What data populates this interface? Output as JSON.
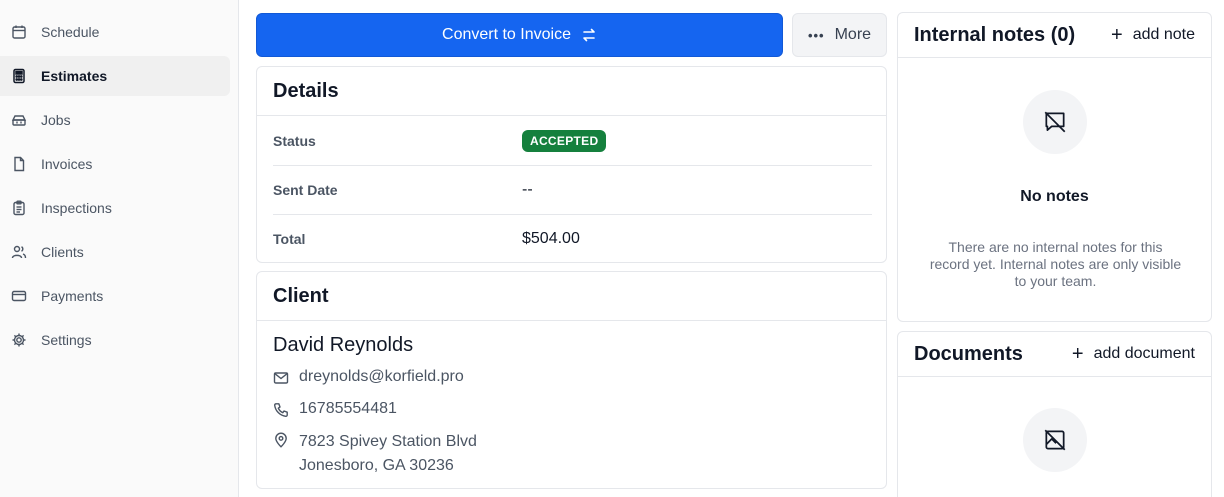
{
  "sidebar": {
    "items": [
      {
        "label": "Schedule",
        "icon": "calendar-icon"
      },
      {
        "label": "Estimates",
        "icon": "calculator-icon",
        "active": true
      },
      {
        "label": "Jobs",
        "icon": "toolbox-icon"
      },
      {
        "label": "Invoices",
        "icon": "file-icon"
      },
      {
        "label": "Inspections",
        "icon": "clipboard-icon"
      },
      {
        "label": "Clients",
        "icon": "users-icon"
      },
      {
        "label": "Payments",
        "icon": "credit-card-icon"
      },
      {
        "label": "Settings",
        "icon": "gear-icon"
      }
    ]
  },
  "actions": {
    "convert_label": "Convert to Invoice",
    "more_label": "More"
  },
  "details": {
    "title": "Details",
    "status_label": "Status",
    "status_value": "ACCEPTED",
    "sent_label": "Sent Date",
    "sent_value": "--",
    "total_label": "Total",
    "total_value": "$504.00"
  },
  "client": {
    "title": "Client",
    "name": "David Reynolds",
    "email": "dreynolds@korfield.pro",
    "phone": "16785554481",
    "address_line1": "7823 Spivey Station Blvd",
    "address_line2": "Jonesboro, GA 30236"
  },
  "notes": {
    "title": "Internal notes (0)",
    "add_label": "add note",
    "empty_title": "No notes",
    "empty_desc": "There are no internal notes for this record yet. Internal notes are only visible to your team."
  },
  "documents": {
    "title": "Documents",
    "add_label": "add document"
  },
  "colors": {
    "primary": "#1565f0",
    "status_accepted": "#15803d"
  }
}
